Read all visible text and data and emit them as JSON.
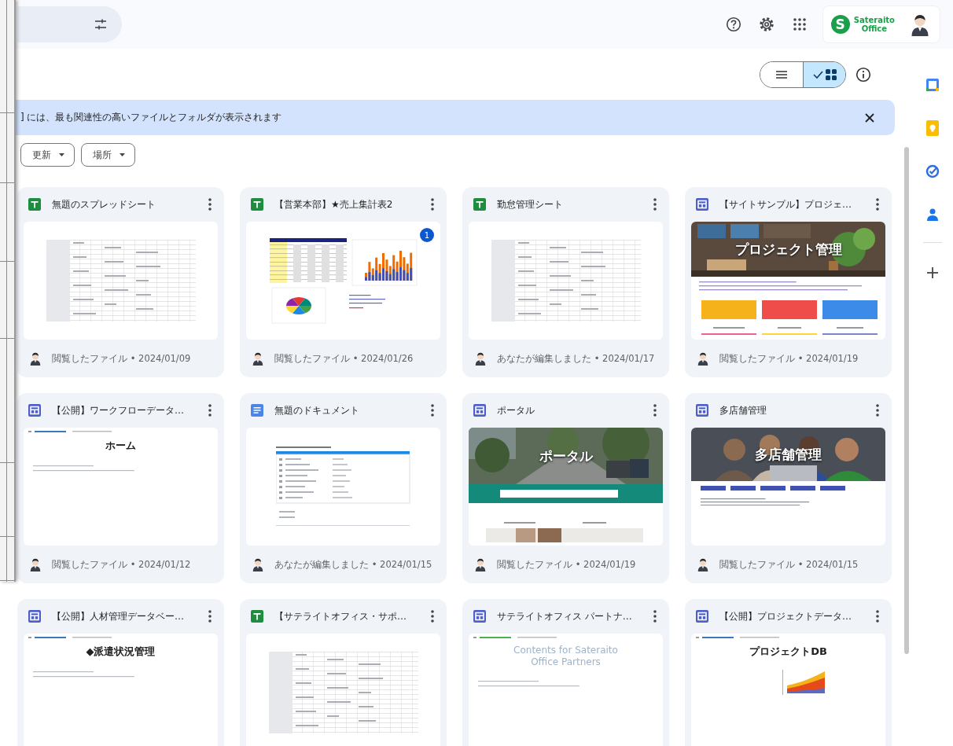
{
  "header": {
    "logo_mark": "S",
    "logo_lines": [
      "Sateraito",
      "Office"
    ]
  },
  "view_toggle": [
    {
      "kind": "list",
      "selected": false
    },
    {
      "kind": "grid",
      "selected": true
    }
  ],
  "banner": {
    "text": "] には、最も関連性の高いファイルとフォルダが表示されます"
  },
  "filters": [
    {
      "label": "更新"
    },
    {
      "label": "場所"
    }
  ],
  "side_rail": [
    {
      "kind": "calendar"
    },
    {
      "kind": "keep"
    },
    {
      "kind": "tasks"
    },
    {
      "kind": "contacts"
    },
    {
      "kind": "add"
    }
  ],
  "files": [
    {
      "kind": "sheet",
      "title": "無題のスプレッドシート",
      "meta": "閲覧したファイル • 2024/01/09",
      "preview": {
        "kind": "sheet"
      }
    },
    {
      "kind": "sheet",
      "title": "【営業本部】★売上集計表2",
      "meta": "閲覧したファイル • 2024/01/26",
      "badge": "1",
      "preview": {
        "kind": "report"
      }
    },
    {
      "kind": "sheet",
      "title": "勤怠管理シート",
      "meta": "あなたが編集しました • 2024/01/17",
      "preview": {
        "kind": "sheet"
      }
    },
    {
      "kind": "site",
      "title": "【サイトサンプル】プロジェ…",
      "meta": "閲覧したファイル • 2024/01/19",
      "preview": {
        "kind": "tiles",
        "heading": "プロジェクト管理"
      }
    },
    {
      "kind": "site",
      "title": "【公開】ワークフローデータ…",
      "meta": "閲覧したファイル • 2024/01/12",
      "preview": {
        "kind": "page",
        "heading": "ホーム"
      }
    },
    {
      "kind": "doc",
      "title": "無題のドキュメント",
      "meta": "あなたが編集しました • 2024/01/15",
      "preview": {
        "kind": "doc"
      }
    },
    {
      "kind": "site",
      "title": "ポータル",
      "meta": "閲覧したファイル • 2024/01/19",
      "preview": {
        "kind": "search",
        "heading": "ポータル"
      }
    },
    {
      "kind": "site",
      "title": "多店舗管理",
      "meta": "閲覧したファイル • 2024/01/15",
      "preview": {
        "kind": "buttons",
        "heading": "多店舗管理"
      }
    },
    {
      "kind": "site",
      "title": "【公開】人材管理データベー…",
      "preview": {
        "kind": "page",
        "heading": "◆派遣状況管理"
      }
    },
    {
      "kind": "sheet",
      "title": "【サテライトオフィス・サポ…",
      "preview": {
        "kind": "sheet"
      }
    },
    {
      "kind": "site",
      "title": "サテライトオフィス パートナ…",
      "preview": {
        "kind": "light-page",
        "heading": "Contents for Sateraito Office Partners"
      }
    },
    {
      "kind": "site",
      "title": "【公開】プロジェクトデータ…",
      "preview": {
        "kind": "page",
        "heading": "プロジェクトDB",
        "chart": true
      }
    }
  ]
}
